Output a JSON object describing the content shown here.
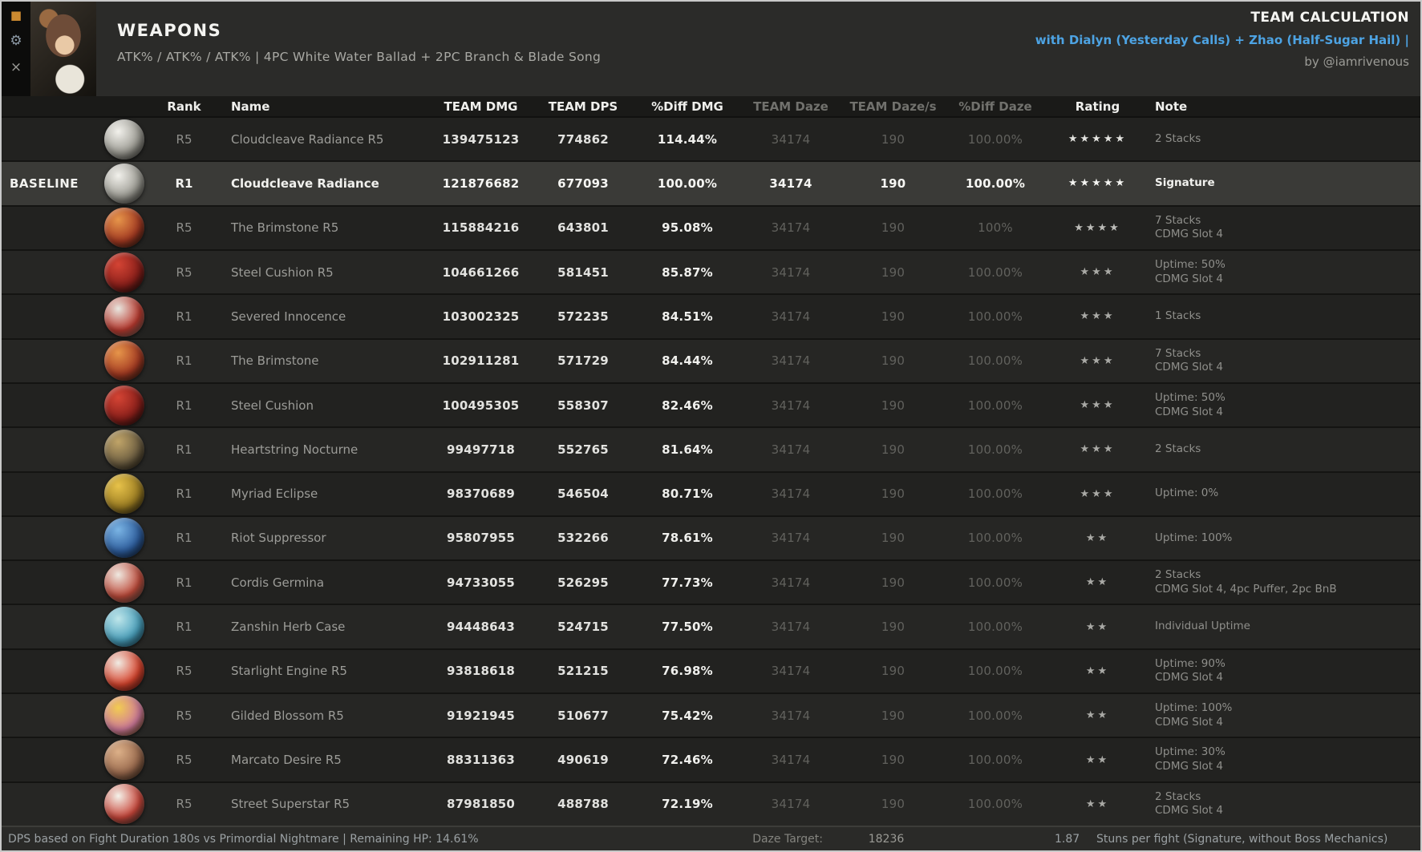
{
  "header": {
    "title": "WEAPONS",
    "subtitle": "ATK% / ATK% / ATK%   |   4PC White Water Ballad + 2PC Branch & Blade Song",
    "right_title": "TEAM CALCULATION",
    "right_subtitle": "with Dialyn (Yesterday Calls) + Zhao (Half-Sugar Hail) |",
    "right_credit": "by @iamrivenous",
    "accent_color": "#4da3e3"
  },
  "side_icons": [
    {
      "name": "badge-icon",
      "glyph": "■",
      "color": "#cc8a30"
    },
    {
      "name": "gear-icon",
      "glyph": "⚙",
      "color": "#8d9aa6"
    },
    {
      "name": "close-icon",
      "glyph": "×",
      "color": "#9a9a96"
    }
  ],
  "table": {
    "columns": [
      {
        "label": "Rank",
        "dim": false
      },
      {
        "label": "Name",
        "dim": false
      },
      {
        "label": "TEAM DMG",
        "dim": false
      },
      {
        "label": "TEAM DPS",
        "dim": false
      },
      {
        "label": "%Diff DMG",
        "dim": false
      },
      {
        "label": "TEAM Daze",
        "dim": true
      },
      {
        "label": "TEAM Daze/s",
        "dim": true
      },
      {
        "label": "%Diff Daze",
        "dim": true
      },
      {
        "label": "Rating",
        "dim": false
      },
      {
        "label": "Note",
        "dim": false
      }
    ],
    "rows": [
      {
        "baseline": "",
        "rank": "R5",
        "name": "Cloudcleave Radiance R5",
        "team_dmg": "139475123",
        "team_dps": "774862",
        "diff_dmg": "114.44%",
        "team_daze": "34174",
        "team_daze_s": "190",
        "diff_daze": "100.00%",
        "stars": 5,
        "note": [
          "2 Stacks"
        ],
        "highlight": false,
        "icon": "cloudcleave-radiance",
        "icon_colors": [
          "#f2f1ec",
          "#9b9a92",
          "#42413c"
        ]
      },
      {
        "baseline": "BASELINE",
        "rank": "R1",
        "name": "Cloudcleave Radiance",
        "team_dmg": "121876682",
        "team_dps": "677093",
        "diff_dmg": "100.00%",
        "team_daze": "34174",
        "team_daze_s": "190",
        "diff_daze": "100.00%",
        "stars": 5,
        "note": [
          "Signature"
        ],
        "highlight": true,
        "icon": "cloudcleave-radiance",
        "icon_colors": [
          "#f2f1ec",
          "#9b9a92",
          "#42413c"
        ]
      },
      {
        "baseline": "",
        "rank": "R5",
        "name": "The Brimstone R5",
        "team_dmg": "115884216",
        "team_dps": "643801",
        "diff_dmg": "95.08%",
        "team_daze": "34174",
        "team_daze_s": "190",
        "diff_daze": "100%",
        "stars": 4,
        "note": [
          "7 Stacks",
          "CDMG Slot 4"
        ],
        "highlight": false,
        "icon": "the-brimstone",
        "icon_colors": [
          "#e6954a",
          "#a43a22",
          "#241a14"
        ]
      },
      {
        "baseline": "",
        "rank": "R5",
        "name": "Steel Cushion R5",
        "team_dmg": "104661266",
        "team_dps": "581451",
        "diff_dmg": "85.87%",
        "team_daze": "34174",
        "team_daze_s": "190",
        "diff_daze": "100.00%",
        "stars": 3,
        "note": [
          "Uptime: 50%",
          "CDMG Slot 4"
        ],
        "highlight": false,
        "icon": "steel-cushion",
        "icon_colors": [
          "#d44434",
          "#8a1f1a",
          "#16100e"
        ]
      },
      {
        "baseline": "",
        "rank": "R1",
        "name": "Severed Innocence",
        "team_dmg": "103002325",
        "team_dps": "572235",
        "diff_dmg": "84.51%",
        "team_daze": "34174",
        "team_daze_s": "190",
        "diff_daze": "100.00%",
        "stars": 3,
        "note": [
          "1 Stacks"
        ],
        "highlight": false,
        "icon": "severed-innocence",
        "icon_colors": [
          "#e9e7e0",
          "#b8392e",
          "#6b685f"
        ]
      },
      {
        "baseline": "",
        "rank": "R1",
        "name": "The Brimstone",
        "team_dmg": "102911281",
        "team_dps": "571729",
        "diff_dmg": "84.44%",
        "team_daze": "34174",
        "team_daze_s": "190",
        "diff_daze": "100.00%",
        "stars": 3,
        "note": [
          "7 Stacks",
          "CDMG Slot 4"
        ],
        "highlight": false,
        "icon": "the-brimstone",
        "icon_colors": [
          "#e6954a",
          "#a43a22",
          "#241a14"
        ]
      },
      {
        "baseline": "",
        "rank": "R1",
        "name": "Steel Cushion",
        "team_dmg": "100495305",
        "team_dps": "558307",
        "diff_dmg": "82.46%",
        "team_daze": "34174",
        "team_daze_s": "190",
        "diff_daze": "100.00%",
        "stars": 3,
        "note": [
          "Uptime: 50%",
          "CDMG Slot 4"
        ],
        "highlight": false,
        "icon": "steel-cushion",
        "icon_colors": [
          "#d44434",
          "#8a1f1a",
          "#16100e"
        ]
      },
      {
        "baseline": "",
        "rank": "R1",
        "name": "Heartstring Nocturne",
        "team_dmg": "99497718",
        "team_dps": "552765",
        "diff_dmg": "81.64%",
        "team_daze": "34174",
        "team_daze_s": "190",
        "diff_daze": "100.00%",
        "stars": 3,
        "note": [
          "2 Stacks"
        ],
        "highlight": false,
        "icon": "heartstring-nocturne",
        "icon_colors": [
          "#c0a468",
          "#6e5f42",
          "#221d14"
        ]
      },
      {
        "baseline": "",
        "rank": "R1",
        "name": "Myriad Eclipse",
        "team_dmg": "98370689",
        "team_dps": "546504",
        "diff_dmg": "80.71%",
        "team_daze": "34174",
        "team_daze_s": "190",
        "diff_daze": "100.00%",
        "stars": 3,
        "note": [
          "Uptime: 0%"
        ],
        "highlight": false,
        "icon": "myriad-eclipse",
        "icon_colors": [
          "#e7c24a",
          "#9c7d22",
          "#2a2414"
        ]
      },
      {
        "baseline": "",
        "rank": "R1",
        "name": "Riot Suppressor",
        "team_dmg": "95807955",
        "team_dps": "532266",
        "diff_dmg": "78.61%",
        "team_daze": "34174",
        "team_daze_s": "190",
        "diff_daze": "100.00%",
        "stars": 2,
        "note": [
          "Uptime: 100%"
        ],
        "highlight": false,
        "icon": "riot-suppressor",
        "icon_colors": [
          "#7ab4e4",
          "#2e5e9e",
          "#122036"
        ]
      },
      {
        "baseline": "",
        "rank": "R1",
        "name": "Cordis Germina",
        "team_dmg": "94733055",
        "team_dps": "526295",
        "diff_dmg": "77.73%",
        "team_daze": "34174",
        "team_daze_s": "190",
        "diff_daze": "100.00%",
        "stars": 2,
        "note": [
          "2 Stacks",
          "CDMG Slot 4, 4pc Puffer, 2pc BnB"
        ],
        "highlight": false,
        "icon": "cordis-germina",
        "icon_colors": [
          "#efe9e1",
          "#bd4a3a",
          "#5c564e"
        ]
      },
      {
        "baseline": "",
        "rank": "R1",
        "name": "Zanshin Herb Case",
        "team_dmg": "94448643",
        "team_dps": "524715",
        "diff_dmg": "77.50%",
        "team_daze": "34174",
        "team_daze_s": "190",
        "diff_daze": "100.00%",
        "stars": 2,
        "note": [
          "Individual Uptime"
        ],
        "highlight": false,
        "icon": "zanshin-herb-case",
        "icon_colors": [
          "#bfe6ea",
          "#4aa0bc",
          "#1c4a5e"
        ]
      },
      {
        "baseline": "",
        "rank": "R5",
        "name": "Starlight Engine R5",
        "team_dmg": "93818618",
        "team_dps": "521215",
        "diff_dmg": "76.98%",
        "team_daze": "34174",
        "team_daze_s": "190",
        "diff_daze": "100.00%",
        "stars": 2,
        "note": [
          "Uptime: 90%",
          "CDMG Slot 4"
        ],
        "highlight": false,
        "icon": "starlight-engine",
        "icon_colors": [
          "#f0ece4",
          "#d8452e",
          "#5e1812"
        ]
      },
      {
        "baseline": "",
        "rank": "R5",
        "name": "Gilded Blossom R5",
        "team_dmg": "91921945",
        "team_dps": "510677",
        "diff_dmg": "75.42%",
        "team_daze": "34174",
        "team_daze_s": "190",
        "diff_daze": "100.00%",
        "stars": 2,
        "note": [
          "Uptime: 100%",
          "CDMG Slot 4"
        ],
        "highlight": false,
        "icon": "gilded-blossom",
        "icon_colors": [
          "#f2cc52",
          "#cf7a9a",
          "#6a4a12"
        ]
      },
      {
        "baseline": "",
        "rank": "R5",
        "name": "Marcato Desire R5",
        "team_dmg": "88311363",
        "team_dps": "490619",
        "diff_dmg": "72.46%",
        "team_daze": "34174",
        "team_daze_s": "190",
        "diff_daze": "100.00%",
        "stars": 2,
        "note": [
          "Uptime: 30%",
          "CDMG Slot 4"
        ],
        "highlight": false,
        "icon": "marcato-desire",
        "icon_colors": [
          "#dcb088",
          "#9a6a4e",
          "#3c2a1e"
        ]
      },
      {
        "baseline": "",
        "rank": "R5",
        "name": "Street Superstar R5",
        "team_dmg": "87981850",
        "team_dps": "488788",
        "diff_dmg": "72.19%",
        "team_daze": "34174",
        "team_daze_s": "190",
        "diff_daze": "100.00%",
        "stars": 2,
        "note": [
          "2 Stacks",
          "CDMG Slot 4"
        ],
        "highlight": false,
        "icon": "street-superstar",
        "icon_colors": [
          "#f4f2ea",
          "#c8463a",
          "#3e3b34"
        ]
      }
    ]
  },
  "footer": {
    "left": "DPS based on Fight Duration 180s vs Primordial Nightmare | Remaining HP: 14.61%",
    "daze_target_label": "Daze Target:",
    "daze_target_value": "18236",
    "stuns_value": "1.87",
    "stuns_label": "Stuns per fight (Signature, without Boss Mechanics)"
  }
}
